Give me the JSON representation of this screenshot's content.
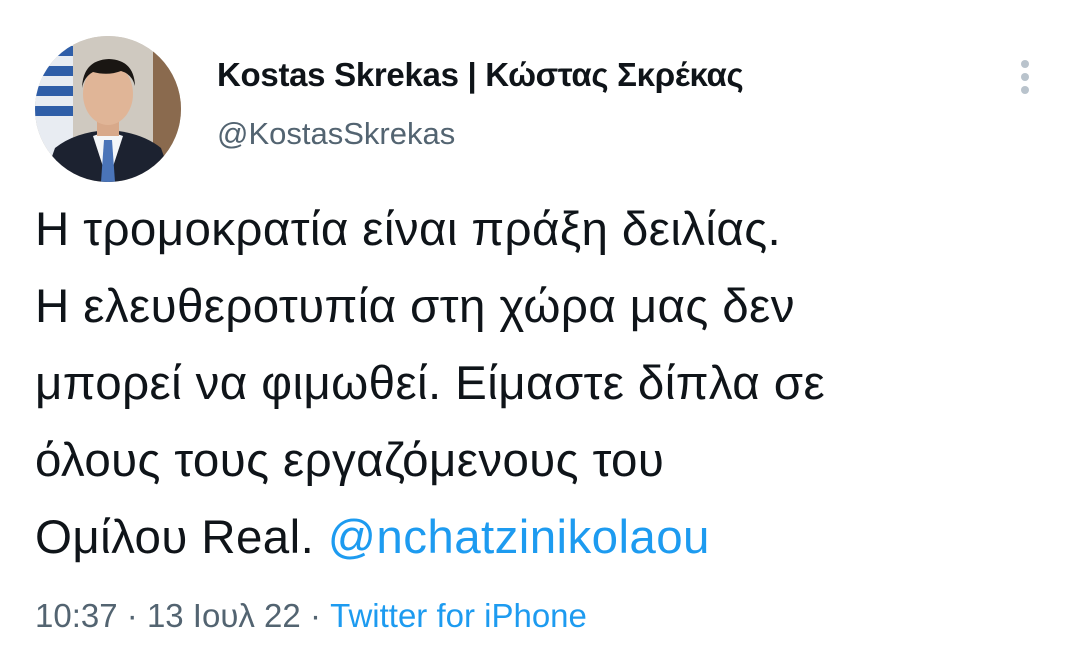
{
  "author": {
    "display_name": "Kostas Skrekas | Κώστας Σκρέκας",
    "handle": "@KostasSkrekas"
  },
  "tweet": {
    "lines": [
      "Η τρομοκρατία είναι πράξη δειλίας.",
      "Η ελευθεροτυπία στη χώρα μας δεν",
      "μπορεί να φιμωθεί. Είμαστε δίπλα σε",
      "όλους τους εργαζόμενους του"
    ],
    "last_line_text": "Ομίλου Real.",
    "mention": "@nchatzinikolaou"
  },
  "meta": {
    "time": "10:37",
    "separator": "·",
    "date": "13 Ιουλ 22",
    "source": "Twitter for iPhone"
  },
  "icons": {
    "more": "more-vertical-icon"
  },
  "colors": {
    "link": "#1d9bf0",
    "secondary_text": "#536471",
    "primary_text": "#0f1419"
  }
}
